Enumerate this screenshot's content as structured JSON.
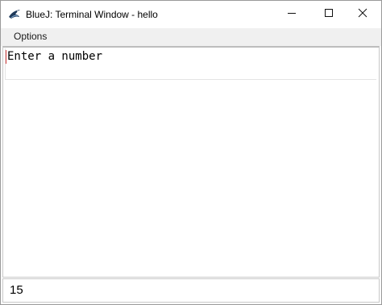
{
  "window": {
    "title": "BlueJ: Terminal Window - hello",
    "app_icon": "bluej-bird-icon"
  },
  "title_buttons": {
    "minimize_icon": "minimize-icon",
    "maximize_icon": "maximize-icon",
    "close_icon": "close-icon"
  },
  "menubar": {
    "options_label": "Options"
  },
  "output": {
    "text": "Enter a number"
  },
  "input": {
    "value": "15"
  },
  "colors": {
    "caret": "#d23b3b",
    "menubar_bg": "#f0f0f0",
    "window_border": "#9a9a9a"
  }
}
